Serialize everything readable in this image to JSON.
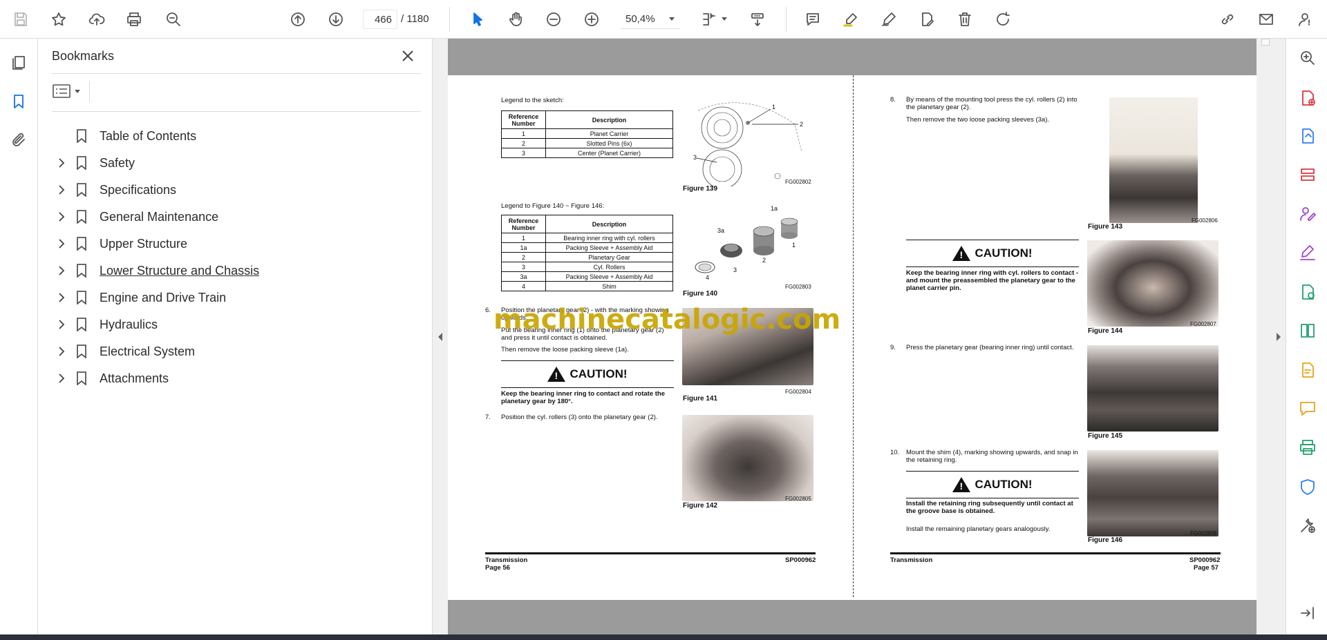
{
  "toolbar": {
    "page_current": "466",
    "page_total": "/ 1180",
    "zoom": "50,4%",
    "icons": [
      "save-icon",
      "star-icon",
      "upload-icon",
      "print-icon",
      "zoom-search-icon",
      "page-up-icon",
      "page-down-icon",
      "select-cursor-icon",
      "hand-icon",
      "zoom-out-icon",
      "zoom-in-icon",
      "fit-page-icon",
      "scroll-mode-icon",
      "comment-icon",
      "highlight-icon",
      "sign-icon",
      "edit-text-icon",
      "delete-icon",
      "rotate-icon",
      "share-link-icon",
      "email-icon",
      "account-icon"
    ]
  },
  "left_rail": {
    "icons": [
      "pages-icon",
      "bookmark-icon",
      "attachment-icon"
    ]
  },
  "bookmarks": {
    "title": "Bookmarks",
    "items": [
      {
        "label": "Table of Contents",
        "expandable": false
      },
      {
        "label": "Safety",
        "expandable": true
      },
      {
        "label": "Specifications",
        "expandable": true
      },
      {
        "label": "General Maintenance",
        "expandable": true
      },
      {
        "label": "Upper Structure",
        "expandable": true
      },
      {
        "label": "Lower Structure and Chassis",
        "expandable": true,
        "hovered": true
      },
      {
        "label": "Engine and Drive Train",
        "expandable": true
      },
      {
        "label": "Hydraulics",
        "expandable": true
      },
      {
        "label": "Electrical System",
        "expandable": true
      },
      {
        "label": "Attachments",
        "expandable": true
      }
    ]
  },
  "document": {
    "watermark": "machinecatalogic.com",
    "left": {
      "legend1": "Legend to the sketch:",
      "table1": {
        "headers": [
          "Reference Number",
          "Description"
        ],
        "rows": [
          [
            "1",
            "Planet Carrier"
          ],
          [
            "2",
            "Slotted Pins (6x)"
          ],
          [
            "3",
            "Center (Planet Carrier)"
          ]
        ]
      },
      "fig139": "Figure 139",
      "fg139": "FG002802",
      "legend2": "Legend to Figure 140 ~ Figure 146:",
      "table2": {
        "headers": [
          "Reference Number",
          "Description"
        ],
        "rows": [
          [
            "1",
            "Bearing inner ring with cyl. rollers"
          ],
          [
            "1a",
            "Packing Sleeve + Assembly Aid"
          ],
          [
            "2",
            "Planetary Gear"
          ],
          [
            "3",
            "Cyl. Rollers"
          ],
          [
            "3a",
            "Packing Sleeve + Assembly Aid"
          ],
          [
            "4",
            "Shim"
          ]
        ]
      },
      "fig140": "Figure 140",
      "fg140": "FG002803",
      "step6_num": "6.",
      "step6_a": "Position the planetary gear (2) - with the marking showing",
      "step6_b": "upwards.",
      "step6_c": "Put the bearing inner ring (1) onto the planetary gear (2)",
      "step6_d": "and press it until contact is obtained.",
      "step6_e": "Then remove the loose packing sleeve (1a).",
      "caution1": "CAUTION!",
      "caution1_a": "Keep the bearing inner ring to contact and rotate the",
      "caution1_b": "planetary gear by 180°.",
      "step7_num": "7.",
      "step7": "Position the cyl. rollers (3) onto the planetary gear (2).",
      "fig141": "Figure 141",
      "fg141": "FG002804",
      "fig142": "Figure 142",
      "fg142": "FG002805",
      "footer_left": "Transmission",
      "footer_page": "Page 56",
      "footer_right": "SP000962"
    },
    "right": {
      "step8_num": "8.",
      "step8_a": "By means of the mounting tool press the cyl. rollers (2) into",
      "step8_b": "the planetary gear (2).",
      "step8_c": "Then remove the two loose packing sleeves (3a).",
      "fig143": "Figure 143",
      "fg143": "FG002806",
      "caution2": "CAUTION!",
      "caution2_a": "Keep the bearing inner ring with cyl. rollers to contact -",
      "caution2_b": "and mount the preassembled the planetary gear to the",
      "caution2_c": "planet carrier pin.",
      "fig144": "Figure 144",
      "fg144": "FG002807",
      "step9_num": "9.",
      "step9": "Press the planetary gear (bearing inner ring) until contact.",
      "fig145": "Figure 145",
      "step10_num": "10.",
      "step10_a": "Mount the shim (4), marking showing upwards, and snap in",
      "step10_b": "the retaining ring.",
      "caution3": "CAUTION!",
      "caution3_a": "Install the retaining ring subsequently until contact at",
      "caution3_b": "the groove base is obtained.",
      "step10_c": "Install the remaining planetary gears analogously.",
      "fig146": "Figure 146",
      "fg146": "FG002809",
      "footer_left": "Transmission",
      "footer_page": "Page 57",
      "footer_right": "SP000962"
    },
    "sketch_labels": {
      "l1": "1",
      "l2": "2",
      "l3": "3"
    },
    "parts_labels": {
      "a": "1a",
      "b": "3a",
      "c": "1",
      "d": "2",
      "e": "3",
      "f": "4"
    }
  }
}
